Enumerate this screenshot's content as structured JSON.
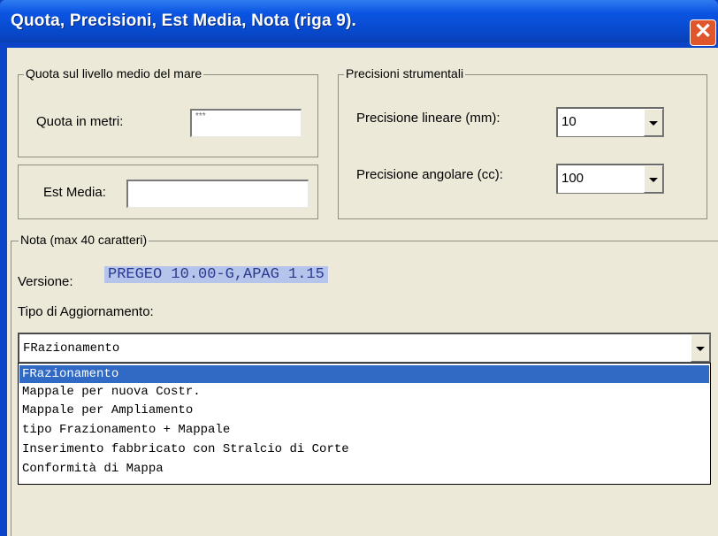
{
  "window": {
    "title": "Quota, Precisioni, Est Media, Nota  (riga 9).",
    "close_glyph": "✕"
  },
  "quota_group": {
    "legend": "Quota sul livello medio del mare",
    "label": "Quota in metri:",
    "value": "***"
  },
  "est_media": {
    "label": "Est Media:",
    "value": ""
  },
  "precisioni_group": {
    "legend": "Precisioni strumentali",
    "lineare_label": "Precisione lineare (mm):",
    "lineare_value": "10",
    "angolare_label": "Precisione  angolare (cc):",
    "angolare_value": "100"
  },
  "nota_group": {
    "legend": "Nota (max 40 caratteri)",
    "version_label": "Versione:",
    "version_value": "PREGEO 10.00-G,APAG 1.15",
    "tipo_label": "Tipo di Aggiornamento:",
    "tipo_selected": "FRazionamento",
    "tipo_options": [
      "FRazionamento",
      "Mappale per nuova Costr.",
      "Mappale per Ampliamento",
      "tipo Frazionamento + Mappale",
      "Inserimento fabbricato con Stralcio di Corte",
      "Conformità di Mappa"
    ],
    "highlighted_index": 0
  },
  "colors": {
    "titlebar": "#0b55e3",
    "dialog_bg": "#ece9d8",
    "selection": "#316ac5",
    "version_highlight": "#b4c4ea"
  }
}
